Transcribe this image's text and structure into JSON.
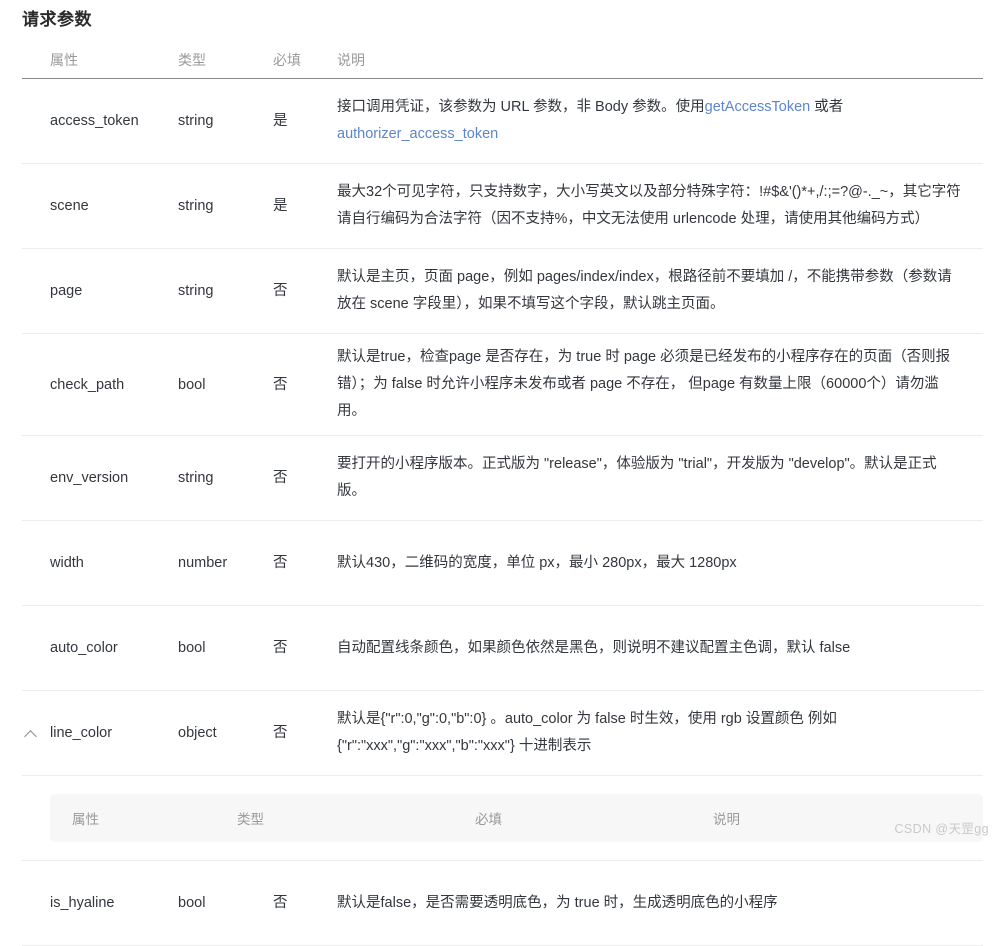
{
  "page": {
    "title": "请求参数",
    "watermark": "CSDN @天罡gg",
    "link_color": "#5c86c9",
    "header_rule_color": "#8a8a8a",
    "row_divider_color": "#ececec",
    "nested_header_bg": "#f7f7f8"
  },
  "table": {
    "columns": {
      "name": "属性",
      "type": "类型",
      "required": "必填",
      "description": "说明"
    },
    "rows": [
      {
        "caret": "",
        "name": "access_token",
        "type": "string",
        "required": "是",
        "desc_parts": [
          {
            "kind": "text",
            "text": "接口调用凭证，该参数为 URL 参数，非 Body 参数。使用"
          },
          {
            "kind": "link",
            "text": "getAccessToken"
          },
          {
            "kind": "text",
            "text": " 或者 "
          },
          {
            "kind": "link",
            "text": "authorizer_access_token"
          }
        ],
        "desc_plain": "接口调用凭证，该参数为 URL 参数，非 Body 参数。使用getAccessToken 或者 authorizer_access_token"
      },
      {
        "caret": "",
        "name": "scene",
        "type": "string",
        "required": "是",
        "desc_plain": "最大32个可见字符，只支持数字，大小写英文以及部分特殊字符：!#$&'()*+,/:;=?@-._~，其它字符请自行编码为合法字符（因不支持%，中文无法使用 urlencode 处理，请使用其他编码方式）"
      },
      {
        "caret": "",
        "name": "page",
        "type": "string",
        "required": "否",
        "desc_plain": "默认是主页，页面 page，例如 pages/index/index，根路径前不要填加 /，不能携带参数（参数请放在 scene 字段里），如果不填写这个字段，默认跳主页面。"
      },
      {
        "caret": "",
        "name": "check_path",
        "type": "bool",
        "required": "否",
        "desc_plain": "默认是true，检查page 是否存在，为 true 时 page 必须是已经发布的小程序存在的页面（否则报错）；为 false 时允许小程序未发布或者 page 不存在， 但page 有数量上限（60000个）请勿滥用。"
      },
      {
        "caret": "",
        "name": "env_version",
        "type": "string",
        "required": "否",
        "desc_plain": "要打开的小程序版本。正式版为 \"release\"，体验版为 \"trial\"，开发版为 \"develop\"。默认是正式版。"
      },
      {
        "caret": "",
        "name": "width",
        "type": "number",
        "required": "否",
        "desc_plain": "默认430，二维码的宽度，单位 px，最小 280px，最大 1280px"
      },
      {
        "caret": "",
        "name": "auto_color",
        "type": "bool",
        "required": "否",
        "desc_plain": "自动配置线条颜色，如果颜色依然是黑色，则说明不建议配置主色调，默认 false"
      },
      {
        "caret": "chevron-up",
        "name": "line_color",
        "type": "object",
        "required": "否",
        "desc_plain": "默认是{\"r\":0,\"g\":0,\"b\":0} 。auto_color 为 false 时生效，使用 rgb 设置颜色 例如 {\"r\":\"xxx\",\"g\":\"xxx\",\"b\":\"xxx\"} 十进制表示"
      },
      {
        "caret": "",
        "name": "is_hyaline",
        "type": "bool",
        "required": "否",
        "desc_plain": "默认是false，是否需要透明底色，为 true 时，生成透明底色的小程序"
      }
    ],
    "nested_table": {
      "parent": "line_color",
      "columns": {
        "name": "属性",
        "type": "类型",
        "required": "必填",
        "description": "说明"
      },
      "rows": []
    }
  }
}
